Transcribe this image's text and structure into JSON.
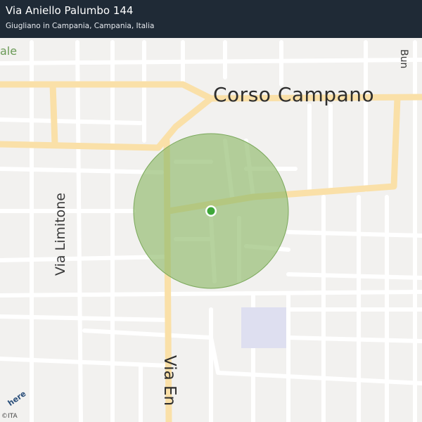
{
  "header": {
    "title": "Via Aniello Palumbo 144",
    "subtitle": "Giugliano in Campania, Campania, Italia"
  },
  "map": {
    "street_labels": {
      "corso": "Corso  Campano",
      "limitone": "Via Limitone",
      "via_en": "Via En",
      "park_fragment": "ale",
      "right_fragment": "Bun"
    },
    "colors": {
      "background": "#f2f1ef",
      "major_road": "#fae0a8",
      "minor_road": "#ffffff",
      "accuracy_circle": "#8fba6a",
      "location_dot": "#3fa73a",
      "block": "#dedff0"
    },
    "attribution": {
      "logo": "here",
      "copyright": "©ITA"
    }
  }
}
